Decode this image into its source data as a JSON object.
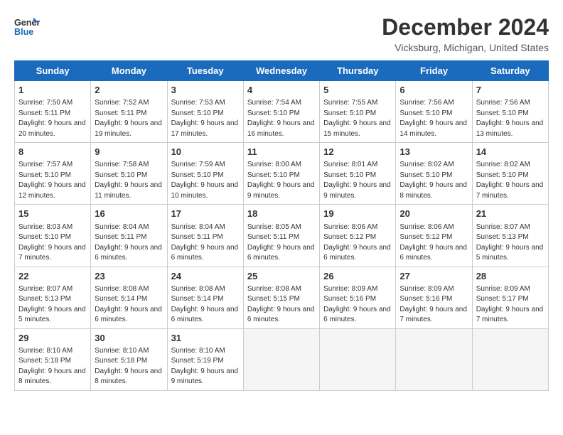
{
  "logo": {
    "line1": "General",
    "line2": "Blue"
  },
  "title": "December 2024",
  "location": "Vicksburg, Michigan, United States",
  "days_of_week": [
    "Sunday",
    "Monday",
    "Tuesday",
    "Wednesday",
    "Thursday",
    "Friday",
    "Saturday"
  ],
  "weeks": [
    [
      {
        "day": "1",
        "sunrise": "7:50 AM",
        "sunset": "5:11 PM",
        "daylight": "9 hours and 20 minutes."
      },
      {
        "day": "2",
        "sunrise": "7:52 AM",
        "sunset": "5:11 PM",
        "daylight": "9 hours and 19 minutes."
      },
      {
        "day": "3",
        "sunrise": "7:53 AM",
        "sunset": "5:10 PM",
        "daylight": "9 hours and 17 minutes."
      },
      {
        "day": "4",
        "sunrise": "7:54 AM",
        "sunset": "5:10 PM",
        "daylight": "9 hours and 16 minutes."
      },
      {
        "day": "5",
        "sunrise": "7:55 AM",
        "sunset": "5:10 PM",
        "daylight": "9 hours and 15 minutes."
      },
      {
        "day": "6",
        "sunrise": "7:56 AM",
        "sunset": "5:10 PM",
        "daylight": "9 hours and 14 minutes."
      },
      {
        "day": "7",
        "sunrise": "7:56 AM",
        "sunset": "5:10 PM",
        "daylight": "9 hours and 13 minutes."
      }
    ],
    [
      {
        "day": "8",
        "sunrise": "7:57 AM",
        "sunset": "5:10 PM",
        "daylight": "9 hours and 12 minutes."
      },
      {
        "day": "9",
        "sunrise": "7:58 AM",
        "sunset": "5:10 PM",
        "daylight": "9 hours and 11 minutes."
      },
      {
        "day": "10",
        "sunrise": "7:59 AM",
        "sunset": "5:10 PM",
        "daylight": "9 hours and 10 minutes."
      },
      {
        "day": "11",
        "sunrise": "8:00 AM",
        "sunset": "5:10 PM",
        "daylight": "9 hours and 9 minutes."
      },
      {
        "day": "12",
        "sunrise": "8:01 AM",
        "sunset": "5:10 PM",
        "daylight": "9 hours and 9 minutes."
      },
      {
        "day": "13",
        "sunrise": "8:02 AM",
        "sunset": "5:10 PM",
        "daylight": "9 hours and 8 minutes."
      },
      {
        "day": "14",
        "sunrise": "8:02 AM",
        "sunset": "5:10 PM",
        "daylight": "9 hours and 7 minutes."
      }
    ],
    [
      {
        "day": "15",
        "sunrise": "8:03 AM",
        "sunset": "5:10 PM",
        "daylight": "9 hours and 7 minutes."
      },
      {
        "day": "16",
        "sunrise": "8:04 AM",
        "sunset": "5:11 PM",
        "daylight": "9 hours and 6 minutes."
      },
      {
        "day": "17",
        "sunrise": "8:04 AM",
        "sunset": "5:11 PM",
        "daylight": "9 hours and 6 minutes."
      },
      {
        "day": "18",
        "sunrise": "8:05 AM",
        "sunset": "5:11 PM",
        "daylight": "9 hours and 6 minutes."
      },
      {
        "day": "19",
        "sunrise": "8:06 AM",
        "sunset": "5:12 PM",
        "daylight": "9 hours and 6 minutes."
      },
      {
        "day": "20",
        "sunrise": "8:06 AM",
        "sunset": "5:12 PM",
        "daylight": "9 hours and 6 minutes."
      },
      {
        "day": "21",
        "sunrise": "8:07 AM",
        "sunset": "5:13 PM",
        "daylight": "9 hours and 5 minutes."
      }
    ],
    [
      {
        "day": "22",
        "sunrise": "8:07 AM",
        "sunset": "5:13 PM",
        "daylight": "9 hours and 5 minutes."
      },
      {
        "day": "23",
        "sunrise": "8:08 AM",
        "sunset": "5:14 PM",
        "daylight": "9 hours and 6 minutes."
      },
      {
        "day": "24",
        "sunrise": "8:08 AM",
        "sunset": "5:14 PM",
        "daylight": "9 hours and 6 minutes."
      },
      {
        "day": "25",
        "sunrise": "8:08 AM",
        "sunset": "5:15 PM",
        "daylight": "9 hours and 6 minutes."
      },
      {
        "day": "26",
        "sunrise": "8:09 AM",
        "sunset": "5:16 PM",
        "daylight": "9 hours and 6 minutes."
      },
      {
        "day": "27",
        "sunrise": "8:09 AM",
        "sunset": "5:16 PM",
        "daylight": "9 hours and 7 minutes."
      },
      {
        "day": "28",
        "sunrise": "8:09 AM",
        "sunset": "5:17 PM",
        "daylight": "9 hours and 7 minutes."
      }
    ],
    [
      {
        "day": "29",
        "sunrise": "8:10 AM",
        "sunset": "5:18 PM",
        "daylight": "9 hours and 8 minutes."
      },
      {
        "day": "30",
        "sunrise": "8:10 AM",
        "sunset": "5:18 PM",
        "daylight": "9 hours and 8 minutes."
      },
      {
        "day": "31",
        "sunrise": "8:10 AM",
        "sunset": "5:19 PM",
        "daylight": "9 hours and 9 minutes."
      },
      null,
      null,
      null,
      null
    ]
  ],
  "labels": {
    "sunrise": "Sunrise:",
    "sunset": "Sunset:",
    "daylight": "Daylight:"
  }
}
